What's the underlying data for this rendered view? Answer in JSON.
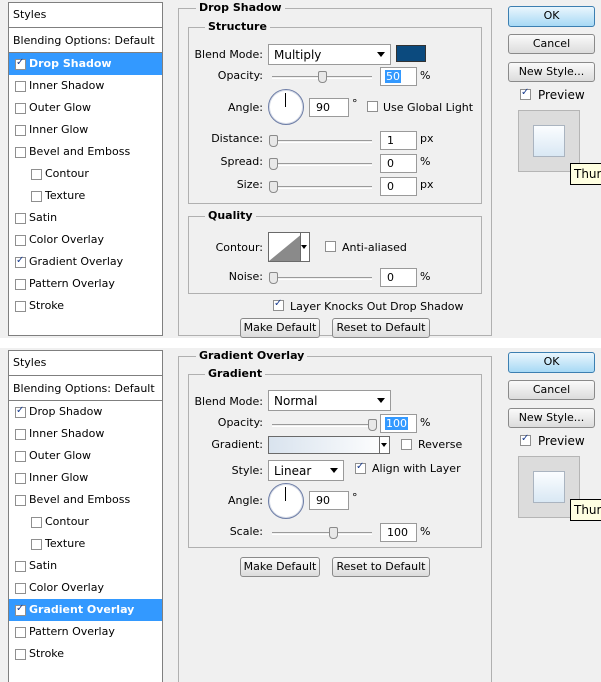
{
  "common": {
    "styles_header": "Styles",
    "blending_options": "Blending Options: Default",
    "ok": "OK",
    "cancel": "Cancel",
    "new_style": "New Style...",
    "preview": "Preview",
    "tooltip": "Thum",
    "make_default": "Make Default",
    "reset_to_default": "Reset to Default",
    "percent": "%",
    "px": "px",
    "degree": "°"
  },
  "style_items": [
    "Drop Shadow",
    "Inner Shadow",
    "Outer Glow",
    "Inner Glow",
    "Bevel and Emboss",
    "Contour",
    "Texture",
    "Satin",
    "Color Overlay",
    "Gradient Overlay",
    "Pattern Overlay",
    "Stroke"
  ],
  "panel1": {
    "title": "Drop Shadow",
    "structure": "Structure",
    "blend_mode_label": "Blend Mode:",
    "blend_mode": "Multiply",
    "shadow_color": "#0b4a7e",
    "opacity_label": "Opacity:",
    "opacity": "50",
    "opacity_fraction": 0.5,
    "angle_label": "Angle:",
    "angle": "90",
    "use_global_light": "Use Global Light",
    "distance_label": "Distance:",
    "distance": "1",
    "spread_label": "Spread:",
    "spread": "0",
    "size_label": "Size:",
    "size": "0",
    "quality": "Quality",
    "contour_label": "Contour:",
    "anti_aliased": "Anti-aliased",
    "noise_label": "Noise:",
    "noise": "0",
    "layer_knocks": "Layer Knocks Out Drop Shadow"
  },
  "panel2": {
    "title": "Gradient Overlay",
    "gradient_group": "Gradient",
    "blend_mode_label": "Blend Mode:",
    "blend_mode": "Normal",
    "opacity_label": "Opacity:",
    "opacity": "100",
    "opacity_fraction": 1.0,
    "gradient_label": "Gradient:",
    "reverse": "Reverse",
    "style_label": "Style:",
    "style": "Linear",
    "align_with_layer": "Align with Layer",
    "angle_label": "Angle:",
    "angle": "90",
    "scale_label": "Scale:",
    "scale": "100"
  }
}
